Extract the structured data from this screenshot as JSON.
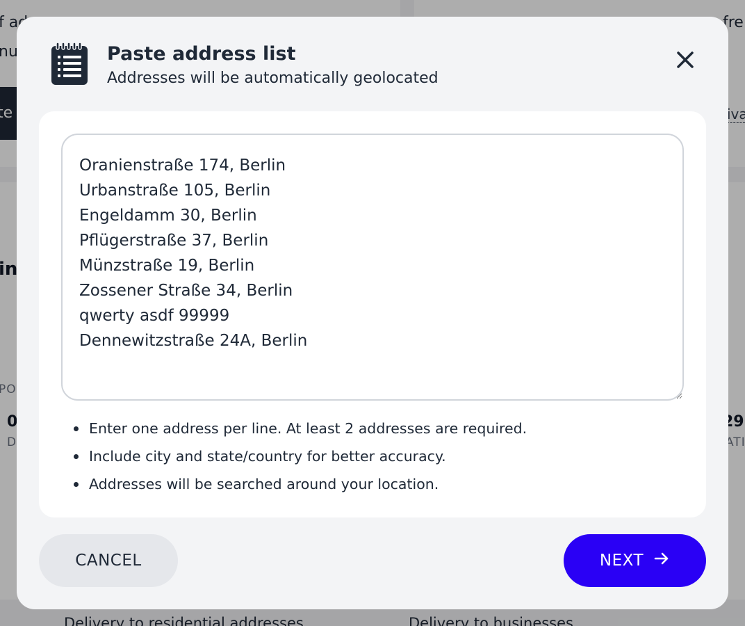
{
  "background": {
    "top_left_fragment_1": "f ad",
    "top_left_fragment_2": "nu",
    "top_right_fragment": "fre",
    "dark_button_fragment": "te",
    "link_fragment": "iva",
    "heading_fragment": "in",
    "label_left_fragment": "PO",
    "num_left_fragment": "0",
    "small_left_fragment": "D",
    "num_right_fragment": "29",
    "small_right_fragment": "ATI",
    "bottom_left_text": "Delivery to residential addresses",
    "bottom_right_text": "Delivery to businesses"
  },
  "modal": {
    "title": "Paste address list",
    "subtitle": "Addresses will be automatically geolocated",
    "header_icon": "notepad-list-icon",
    "close_icon": "close-icon",
    "textarea_value": "Oranienstraße 174, Berlin\nUrbanstraße 105, Berlin\nEngeldamm 30, Berlin\nPflügerstraße 37, Berlin\nMünzstraße 19, Berlin\nZossener Straße 34, Berlin\nqwerty asdf 99999\nDennewitzstraße 24A, Berlin",
    "hints": [
      "Enter one address per line. At least 2 addresses are required.",
      "Include city and state/country for better accuracy.",
      "Addresses will be searched around your location."
    ],
    "cancel_label": "CANCEL",
    "next_label": "NEXT",
    "next_icon": "arrow-right-icon"
  },
  "colors": {
    "primary": "#2a00f5",
    "text": "#1f2937",
    "modal_bg": "#f3f4f6",
    "cancel_bg": "#e5e7eb"
  }
}
